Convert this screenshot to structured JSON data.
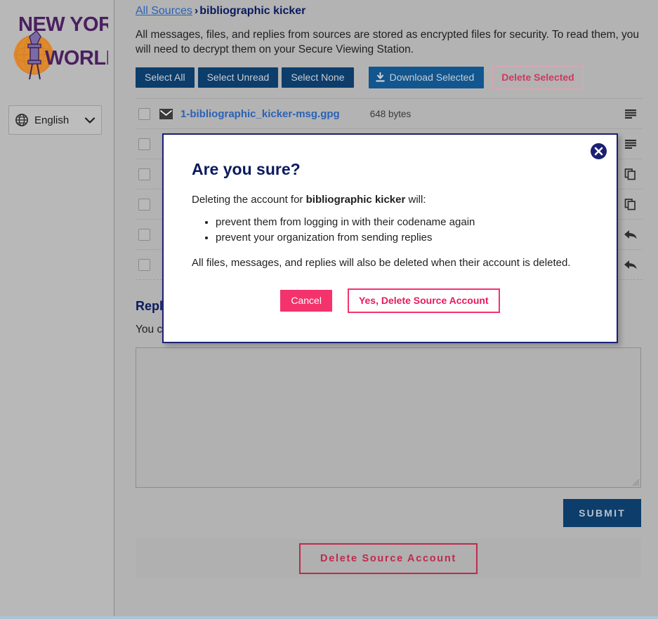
{
  "sidebar": {
    "logo": {
      "line1": "NEW YORK",
      "line2": "WORLD",
      "icon": "torch-globe-icon",
      "color": "#4a2060",
      "accent": "#e08a2e"
    },
    "language_selector": {
      "icon": "globe-icon",
      "value": "English",
      "caret": "chevron-down-icon"
    }
  },
  "breadcrumb": {
    "root": "All Sources",
    "separator": "›",
    "current": "bibliographic kicker"
  },
  "intro": "All messages, files, and replies from sources are stored as encrypted files for security. To read them, you will need to decrypt them on your Secure Viewing Station.",
  "toolbar": {
    "select_all": "Select All",
    "select_unread": "Select Unread",
    "select_none": "Select None",
    "download_selected": "Download Selected",
    "download_icon": "download-icon",
    "delete_selected": "Delete Selected"
  },
  "documents": [
    {
      "name": "1-bibliographic_kicker-msg.gpg",
      "size": "648 bytes",
      "type_icon": "mail-icon",
      "row_icon": "message-lines-icon",
      "checked": false
    },
    {
      "name": "",
      "size": "",
      "type_icon": "",
      "row_icon": "message-lines-icon",
      "checked": false
    },
    {
      "name": "",
      "size": "",
      "type_icon": "",
      "row_icon": "document-copy-icon",
      "checked": false
    },
    {
      "name": "",
      "size": "",
      "type_icon": "",
      "row_icon": "document-copy-icon",
      "checked": false
    },
    {
      "name": "",
      "size": "",
      "type_icon": "",
      "row_icon": "reply-arrow-icon",
      "checked": false
    },
    {
      "name": "",
      "size": "",
      "type_icon": "",
      "row_icon": "reply-arrow-icon",
      "checked": false
    }
  ],
  "reply": {
    "heading": "Reply",
    "subtext": "You can write a secure reply to the person who submitted these messages and/or files:",
    "textarea_value": "",
    "textarea_placeholder": "",
    "submit_label": "SUBMIT"
  },
  "delete_account": {
    "label": "Delete Source Account"
  },
  "modal": {
    "close_icon": "close-icon",
    "title": "Are you sure?",
    "lead_prefix": "Deleting the account for ",
    "lead_bold": "bibliographic kicker",
    "lead_suffix": " will:",
    "bullets": [
      "prevent them from logging in with their codename again",
      "prevent your organization from sending replies"
    ],
    "note": "All files, messages, and replies will also be deleted when their account is deleted.",
    "cancel_label": "Cancel",
    "confirm_label": "Yes, Delete Source Account"
  },
  "colors": {
    "navy": "#0b1a5e",
    "link_blue": "#2a62b6",
    "button_navy": "#0c3d6b",
    "button_blue": "#12568f",
    "pink": "#f4326b",
    "crimson": "#c0294d",
    "page_bg": "#b3b3b3"
  }
}
